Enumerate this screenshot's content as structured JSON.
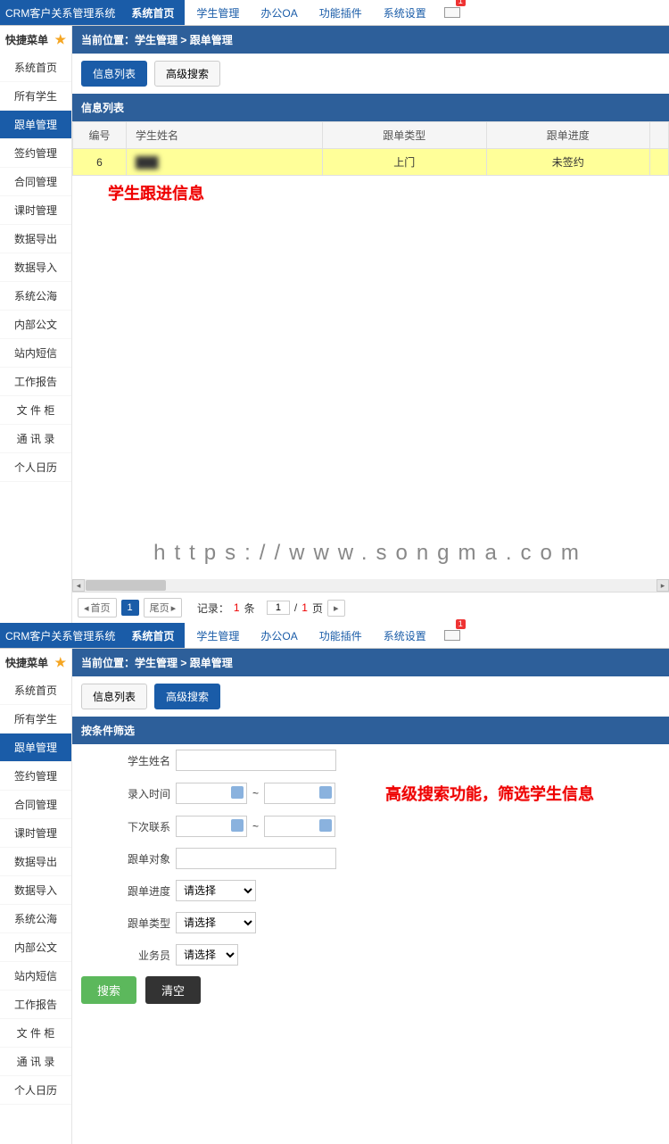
{
  "brand": "CRM客户关系管理系统",
  "topnav": [
    "系统首页",
    "学生管理",
    "办公OA",
    "功能插件",
    "系统设置"
  ],
  "mail_badge": "1",
  "sidebar": {
    "title": "快捷菜单",
    "items": [
      "系统首页",
      "所有学生",
      "跟单管理",
      "签约管理",
      "合同管理",
      "课时管理",
      "数据导出",
      "数据导入",
      "系统公海",
      "内部公文",
      "站内短信",
      "工作报告",
      "文 件 柜",
      "通 讯 录",
      "个人日历"
    ],
    "active_index": 2
  },
  "crumb": {
    "prefix": "当前位置：",
    "path": "学生管理 > 跟单管理"
  },
  "tabs": {
    "info": "信息列表",
    "adv": "高级搜索"
  },
  "view1": {
    "panel_title": "信息列表",
    "cols": [
      "编号",
      "学生姓名",
      "跟单类型",
      "跟单进度"
    ],
    "row": {
      "no": "6",
      "name": "███",
      "type": "上门",
      "progress": "未签约"
    },
    "annotation": "学生跟进信息"
  },
  "watermark": "https://www.songma.com",
  "pager": {
    "first": "首页",
    "last": "尾页",
    "page_current": "1",
    "record_label_pre": "记录：",
    "record_count": "1",
    "record_unit": "条",
    "page_input": "1",
    "page_sep": "/",
    "page_total": "1",
    "page_unit": "页"
  },
  "view2": {
    "panel_title": "按条件筛选",
    "labels": {
      "name": "学生姓名",
      "entry": "录入时间",
      "next": "下次联系",
      "target": "跟单对象",
      "progress": "跟单进度",
      "type": "跟单类型",
      "agent": "业务员"
    },
    "range_sep": "~",
    "select_placeholder": "请选择",
    "btn_search": "搜索",
    "btn_clear": "清空",
    "annotation": "高级搜索功能，筛选学生信息"
  }
}
